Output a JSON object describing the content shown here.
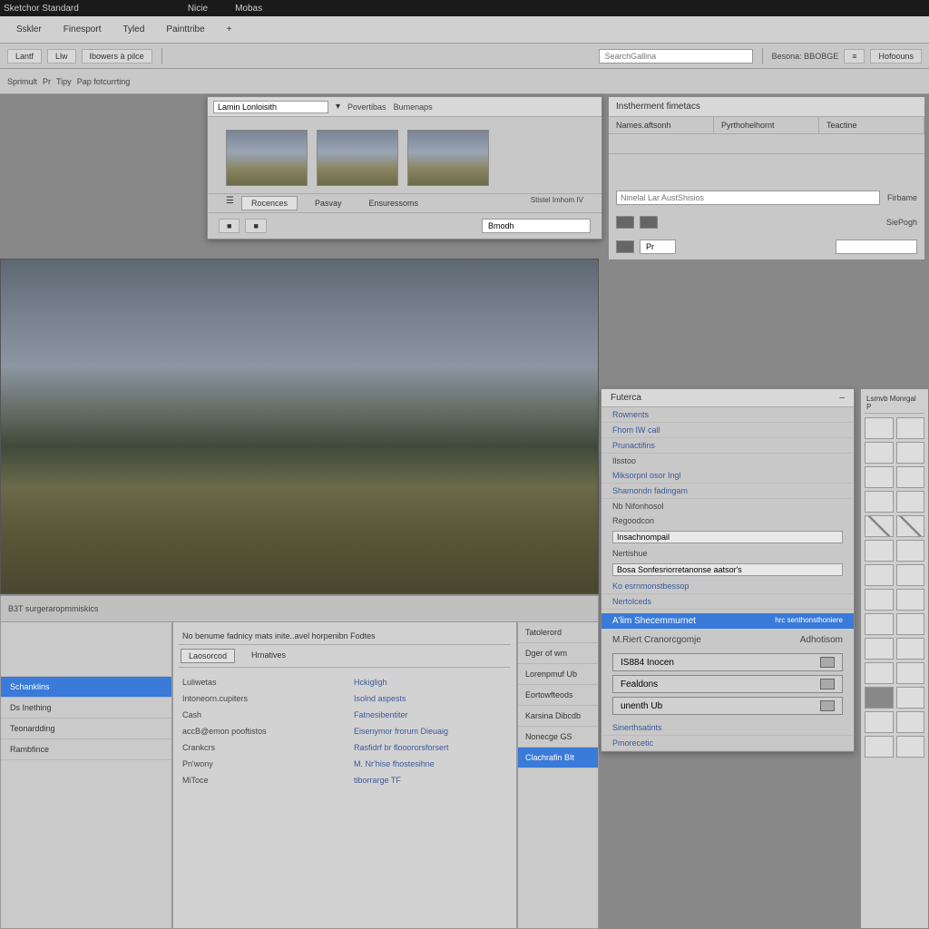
{
  "titlebar": {
    "app": "Sketchor Standard",
    "m1": "Nicie",
    "m2": "Mobas"
  },
  "menu": {
    "i1": "Sskler",
    "i2": "Finesport",
    "i3": "Tyled",
    "i4": "Painttribe",
    "i5": "+"
  },
  "tb1": {
    "b1": "Lantf",
    "b2": "Llw",
    "b3": "Ibowers à pilce",
    "spacer": "",
    "search": "SearchGallina",
    "bdg": "Besona: BBOBGE",
    "icn": "≡",
    "hop": "Hofoouns"
  },
  "tb2": {
    "l1": "Sprimult",
    "l2": "Pr",
    "l3": "Tipy",
    "l4": "Pap fotcurrting"
  },
  "upper": {
    "title": "Lamin Lonloisith",
    "tab1": "Povertibas",
    "tab2": "Bumenaps",
    "t_recents": "Rocences",
    "t_pasvay": "Pasvay",
    "t_ensure": "Ensuressoms",
    "tag": "Stistel Imhom  IV",
    "binput": "Bmodh"
  },
  "ru": {
    "title": "Instherment fimetacs",
    "c1": "Names.aftsonh",
    "c2": "Pyrthohelhornt",
    "c3": "Teactine",
    "midlbl": "Ninelal Lar AustShisios",
    "midval": "",
    "rlbl": "Firbame",
    "blbl": "SiePogh",
    "rinput": "Pr"
  },
  "insp": {
    "title": "Futerca",
    "s_rownets": "Rownents",
    "s_fhom": "Fhom IW call",
    "s_pruc": "Prunactifins",
    "s_esstoo": "Ilsstoo",
    "s_misor": "Miksorpnl osor Ingl",
    "s_shamon": "Shamondn fadingam",
    "s_nb": "Nb Nifonhosol",
    "s_kegood": "Regoodcon",
    "f_insachn": "Insachnompail",
    "f_nertish": "Nertishue",
    "f_bosa": "Bosa Sonfesriorretanonse aatsor's",
    "s_kdes": "Ko esrnmonstbessop",
    "s_nerto": "Nertolceds",
    "hl_aim": "A'lim Shecemmurnet",
    "hl_info": "hrc senthonsthoniere",
    "h_met": "M.Riert Cranorcgomje",
    "h_adm": "Adhotisom",
    "b1": "IS884 Inocen",
    "b2": "Fealdons",
    "b3": "unenth Ub",
    "s_sinerth": "Sinerthsatints",
    "s_pmore": "Pmorecetic"
  },
  "toolstrip": {
    "title": "Lsmvb Monrgal P"
  },
  "bot": {
    "strip": "B3T surgeraropmmiskics",
    "list": {
      "i0": "",
      "i1": "Schanklins",
      "i2": "Ds Inething",
      "i3": "Teonardding",
      "i4": "Rambfince"
    },
    "props": {
      "hdr": "No benume fadnicy mats inite..avel horpenibn Fodtes",
      "t1": "Laosorcod",
      "t2": "Hrnatives",
      "k0": "Luliwetas",
      "v0": "Hckigligh",
      "k1": "Intoneorn.cupiters",
      "v1": "Isolnd aspests",
      "k2": "Cash",
      "v2": "Fatnesibentiter",
      "k3": "accB@emon pooftistos",
      "v3": "Eisenymor frorum Dieuaig",
      "k4": "Crankcrs",
      "v4": "Rasfidrf br flooororsforsert",
      "k5": "Pn'wony",
      "v5": "M. Nr'hise fhostesihne",
      "k6": "MiToce",
      "v6": "tiborrarge TF"
    },
    "props2": {
      "i0": "Tatolerord",
      "i1": "Dger of wm",
      "i2": "Lorenpmuf Ub",
      "i3": "Eortowfteods",
      "i4": "Karsina Dibcdb",
      "i5": "Nonecge GS",
      "i6": "Clachrafin BIt"
    }
  }
}
